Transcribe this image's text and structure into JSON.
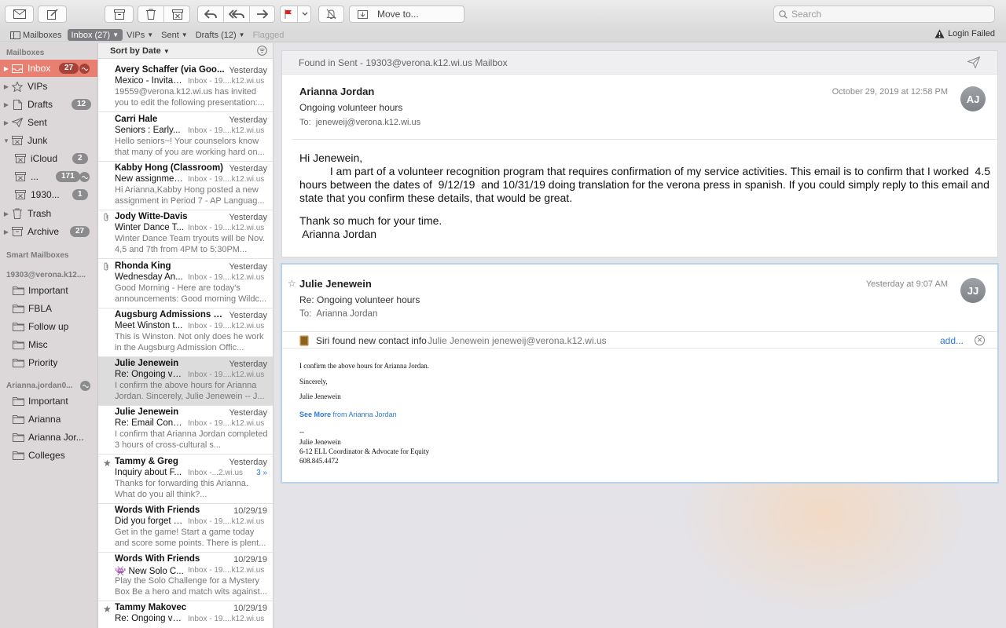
{
  "toolbar": {
    "move_to_label": "Move to...",
    "search_placeholder": "Search"
  },
  "favorites": {
    "mailboxes": "Mailboxes",
    "inbox": "Inbox (27)",
    "vips": "VIPs",
    "sent": "Sent",
    "drafts": "Drafts (12)",
    "flagged": "Flagged",
    "login_failed": "Login Failed"
  },
  "sidebar": {
    "mailboxes_heading": "Mailboxes",
    "items": [
      {
        "label": "Inbox",
        "badge": "27",
        "icon": "inbox-icon"
      },
      {
        "label": "VIPs",
        "icon": "star-icon"
      },
      {
        "label": "Drafts",
        "badge": "12",
        "icon": "document-icon"
      },
      {
        "label": "Sent",
        "icon": "paper-plane-icon"
      },
      {
        "label": "Junk",
        "icon": "junk-icon"
      },
      {
        "label": "iCloud",
        "badge": "2",
        "icon": "junk-icon"
      },
      {
        "label": "...",
        "badge": "171",
        "icon": "junk-icon"
      },
      {
        "label": "1930...",
        "badge": "1",
        "icon": "junk-icon"
      },
      {
        "label": "Trash",
        "icon": "trash-icon"
      },
      {
        "label": "Archive",
        "badge": "27",
        "icon": "archive-icon"
      }
    ],
    "smart_heading": "Smart Mailboxes",
    "account1_heading": "19303@verona.k12....",
    "account1_folders": [
      "Important",
      "FBLA",
      "Follow up",
      "Misc",
      "Priority"
    ],
    "account2_heading": "Arianna.jordan0...",
    "account2_folders": [
      "Important",
      "Arianna",
      "Arianna Jor...",
      "Colleges"
    ]
  },
  "message_list": {
    "sort_label": "Sort by Date",
    "messages": [
      {
        "sender": "Avery Schaffer (via Goo...",
        "date": "Yesterday",
        "subject": "Mexico - Invitati...",
        "mailbox": "Inbox - 19....k12.wi.us",
        "preview": "19559@verona.k12.wi.us has invited you to edit the following presentation:..."
      },
      {
        "sender": "Carri Hale",
        "date": "Yesterday",
        "subject": "Seniors : Early...",
        "mailbox": "Inbox - 19....k12.wi.us",
        "preview": "Hello seniors~! Your counselors know that many of you are working hard on..."
      },
      {
        "sender": "Kabby Hong (Classroom)",
        "date": "Yesterday",
        "subject": "New assignmen...",
        "mailbox": "Inbox - 19....k12.wi.us",
        "preview": "Hi Arianna,Kabby Hong posted a new assignment in Period 7 - AP Languag..."
      },
      {
        "sender": "Jody Witte-Davis",
        "date": "Yesterday",
        "subject": "Winter Dance T...",
        "mailbox": "Inbox - 19....k12.wi.us",
        "preview": "Winter Dance Team tryouts will be Nov. 4,5 and 7th from 4PM to 5:30PM..."
      },
      {
        "sender": "Rhonda King",
        "date": "Yesterday",
        "subject": "Wednesday An...",
        "mailbox": "Inbox - 19....k12.wi.us",
        "preview": "Good Morning -  Here are today's announcements: Good morning Wildc..."
      },
      {
        "sender": "Augsburg Admissions Te...",
        "date": "Yesterday",
        "subject": "Meet Winston t...",
        "mailbox": "Inbox - 19....k12.wi.us",
        "preview": "This is Winston. Not only does he work in the Augsburg Admission Offic..."
      },
      {
        "sender": "Julie Jenewein",
        "date": "Yesterday",
        "subject": "Re: Ongoing vol...",
        "mailbox": "Inbox - 19....k12.wi.us",
        "preview": "I confirm the above hours for Arianna Jordan. Sincerely, Julie Jenewein -- J..."
      },
      {
        "sender": "Julie Jenewein",
        "date": "Yesterday",
        "subject": "Re: Email Confir...",
        "mailbox": "Inbox - 19....k12.wi.us",
        "preview": "I confirm that Arianna Jordan completed 3 hours of cross-cultural s..."
      },
      {
        "sender": "Tammy & Greg",
        "date": "Yesterday",
        "subject": "Inquiry about F...",
        "mailbox": "Inbox -...2.wi.us",
        "thread": "3 »",
        "preview": "Thanks for forwarding this Arianna.  What do you all think?..."
      },
      {
        "sender": "Words With Friends",
        "date": "10/29/19",
        "subject": "Did you forget a...",
        "mailbox": "Inbox - 19....k12.wi.us",
        "preview": "Get in the game! Start a game today and score some points. There is plent..."
      },
      {
        "sender": "Words With Friends",
        "date": "10/29/19",
        "subject": "👾 New Solo C...",
        "mailbox": "Inbox - 19....k12.wi.us",
        "preview": "Play the Solo Challenge for a Mystery Box Be a hero and match wits against..."
      },
      {
        "sender": "Tammy Makovec",
        "date": "10/29/19",
        "subject": "Re: Ongoing vol...",
        "mailbox": "Inbox - 19....k12.wi.us",
        "preview": ""
      }
    ]
  },
  "reader": {
    "found_in": "Found in Sent - 19303@verona.k12.wi.us Mailbox",
    "msg1": {
      "from": "Arianna Jordan",
      "subject": "Ongoing volunteer hours",
      "to_label": "To:",
      "to": "jeneweij@verona.k12.wi.us",
      "date": "October 29, 2019 at 12:58 PM",
      "initials": "AJ",
      "greeting": "Hi Jenewein,",
      "para": "          I am part of a volunteer recognition program that requires confirmation of my service activities. This email is to confirm that I worked  4.5  hours between the dates of  9/12/19  and 10/31/19 doing translation for the verona press in spanish. If you could simply reply to this email and state that you confirm these details, that would be great.",
      "thanks": "Thank so much for your time.",
      "signoff": " Arianna Jordan"
    },
    "msg2": {
      "from": "Julie Jenewein",
      "subject": "Re: Ongoing volunteer hours",
      "to_label": "To:",
      "to": "Arianna Jordan",
      "date": "Yesterday at 9:07 AM",
      "initials": "JJ",
      "siri_text": "Siri found new contact info",
      "siri_contact": "Julie Jenewein jeneweij@verona.k12.wi.us",
      "siri_add": "add...",
      "body_line1": "I confirm the above hours for Arianna Jordan.",
      "body_line2": "Sincerely,",
      "body_line3": "Julie Jenewein",
      "see_more": "See More",
      "see_more_from": " from Arianna Jordan",
      "sig_dash": "--",
      "sig_name": "Julie Jenewein",
      "sig_title": "6-12 ELL Coordinator & Advocate for Equity",
      "sig_phone": "608.845.4472"
    }
  },
  "colors": {
    "selected_mailbox": "#e97f70",
    "link_blue": "#2f7bd8",
    "flag_red": "#e02020"
  }
}
